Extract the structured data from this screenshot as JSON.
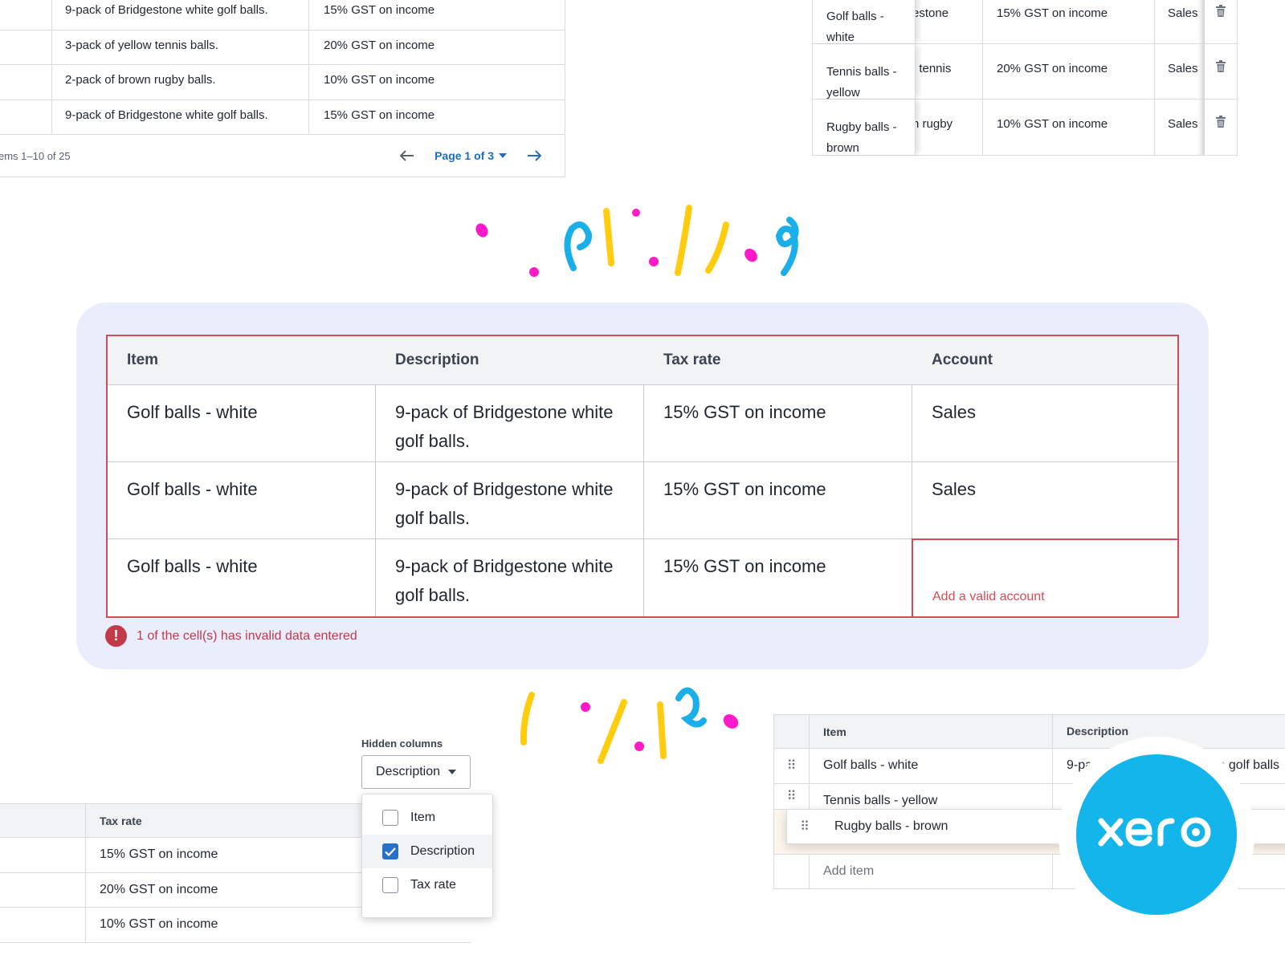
{
  "top_left_table": {
    "rows": [
      {
        "description": "9-pack of Bridgestone white golf balls.",
        "tax_rate": "15% GST on income"
      },
      {
        "description": "3-pack of yellow tennis balls.",
        "tax_rate": "20% GST on income"
      },
      {
        "description": "2-pack of brown rugby balls.",
        "tax_rate": "10% GST on income"
      },
      {
        "description": "9-pack of Bridgestone white golf balls.",
        "tax_rate": "15% GST on income"
      }
    ],
    "pager": {
      "count": "ems 1–10 of 25",
      "page_label": "Page 1 of 3"
    }
  },
  "top_right_table": {
    "rows": [
      {
        "item": "Golf balls - white",
        "desc_fragment": "estone",
        "tax_rate": "15% GST on income",
        "account": "Sales"
      },
      {
        "item": "Tennis balls - yellow",
        "desc_fragment": "/ tennis",
        "tax_rate": "20% GST on income",
        "account": "Sales"
      },
      {
        "item": "Rugby balls - brown",
        "desc_fragment": "n rugby",
        "tax_rate": "10% GST on income",
        "account": "Sales"
      }
    ]
  },
  "main_grid": {
    "headers": [
      "Item",
      "Description",
      "Tax rate",
      "Account"
    ],
    "rows": [
      {
        "item": "Golf balls - white",
        "description": "9-pack of Bridgestone white golf balls.",
        "tax_rate": "15% GST on income",
        "account": "Sales"
      },
      {
        "item": "Golf balls - white",
        "description": "9-pack of Bridgestone white golf balls.",
        "tax_rate": "15% GST on income",
        "account": "Sales"
      },
      {
        "item": "Golf balls - white",
        "description": "9-pack of Bridgestone white golf balls.",
        "tax_rate": "15% GST on income",
        "account": ""
      }
    ],
    "invalid_hint": "Add a valid account",
    "error_message": "1 of the cell(s) has invalid data entered",
    "error_icon": "!"
  },
  "hidden_columns": {
    "label": "Hidden columns",
    "selected": "Description",
    "options": [
      {
        "label": "Item",
        "checked": false
      },
      {
        "label": "Description",
        "checked": true
      },
      {
        "label": "Tax rate",
        "checked": false
      }
    ],
    "table_header": "Tax rate",
    "table_rows": [
      "15% GST on income",
      "20% GST on income",
      "10% GST on income"
    ]
  },
  "drag_table": {
    "headers": {
      "item": "Item",
      "description": "Description"
    },
    "rows": [
      {
        "item": "Golf balls - white",
        "description": "9-pack of Bridgestone white golf balls"
      },
      {
        "item": "Tennis balls - yellow",
        "description": ""
      }
    ],
    "dragging_item": "Rugby balls - brown",
    "add_item": "Add item",
    "handle_icon": "⠿"
  },
  "logo": {
    "text": "xero",
    "color": "#13b5ea"
  },
  "colors": {
    "error": "#d84a55",
    "accent": "#1c6fc4",
    "card_bg": "#eaedfb",
    "confetti_pink": "#ff19c8",
    "confetti_yellow": "#ffcc0f",
    "confetti_blue": "#1aafe8"
  }
}
